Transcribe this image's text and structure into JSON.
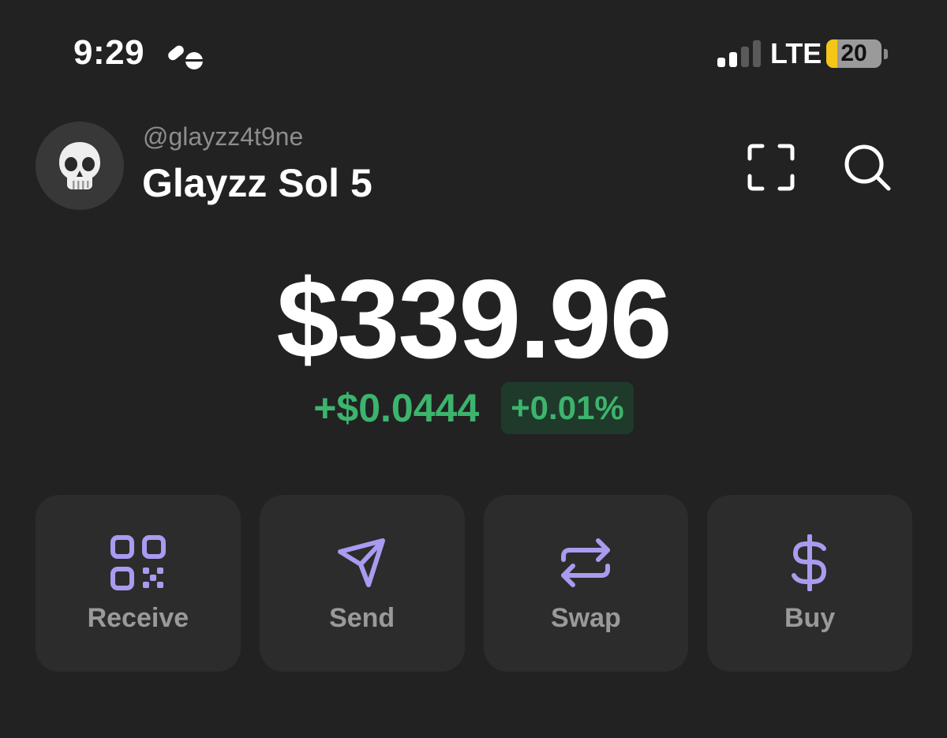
{
  "status_bar": {
    "time": "9:29",
    "focus_icon": "focus-mode-icon",
    "signal_icon": "cellular-signal-icon",
    "signal_bars_active": 2,
    "signal_bars_total": 4,
    "network": "LTE",
    "battery_level": "20",
    "battery_fraction": 0.2,
    "battery_fill_color": "#f5c518"
  },
  "header": {
    "avatar_emoji": "💀",
    "username": "@glayzz4t9ne",
    "account_name": "Glayzz Sol 5",
    "scan_icon": "scan-icon",
    "search_icon": "search-icon"
  },
  "balance": {
    "amount": "$339.96",
    "change_amount": "+$0.0444",
    "change_percent": "+0.01%",
    "positive_color": "#3cb46d"
  },
  "actions": [
    {
      "label": "Receive",
      "icon": "qr-code-icon"
    },
    {
      "label": "Send",
      "icon": "send-icon"
    },
    {
      "label": "Swap",
      "icon": "swap-icon"
    },
    {
      "label": "Buy",
      "icon": "dollar-icon"
    }
  ],
  "accent_color": "#a99bf0"
}
